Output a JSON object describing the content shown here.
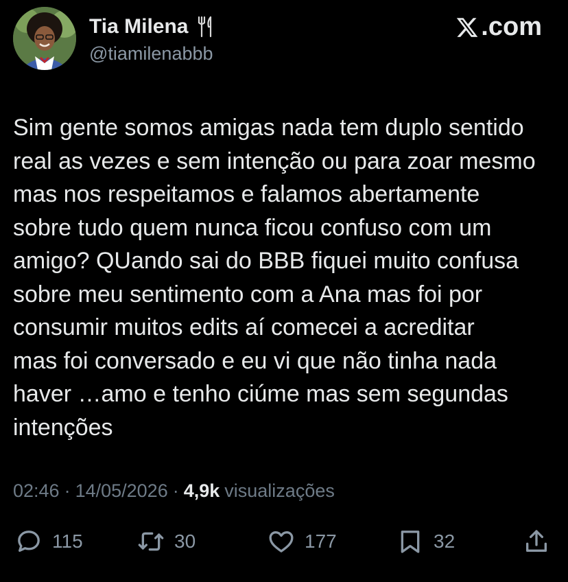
{
  "author": {
    "name": "Tia Milena",
    "handle": "@tiamilenabbb",
    "badge_icon": "fork-knife-icon"
  },
  "brand": {
    "icon": "x-logo-icon",
    "text": ".com"
  },
  "tweet": {
    "text": "Sim gente somos amigas nada tem duplo sentido\nreal as vezes e sem intenção ou para zoar mesmo\nmas nos respeitamos e falamos abertamente\nsobre tudo quem nunca ficou confuso com um\namigo? QUando sai do BBB fiquei muito confusa\nsobre meu sentimento com a Ana mas foi por\nconsumir muitos edits aí comecei a acreditar\nmas foi conversado e eu vi que não tinha nada\nhaver …amo e tenho ciúme mas sem segundas\nintenções"
  },
  "meta": {
    "time": "02:46",
    "separator": "·",
    "date": "14/05/2026",
    "views_count": "4,9k",
    "views_label": "visualizações"
  },
  "actions": {
    "replies": "115",
    "retweets": "30",
    "likes": "177",
    "bookmarks": "32"
  },
  "colors": {
    "background": "#000000",
    "text": "#e7e9ea",
    "secondary": "#8b98a5"
  }
}
